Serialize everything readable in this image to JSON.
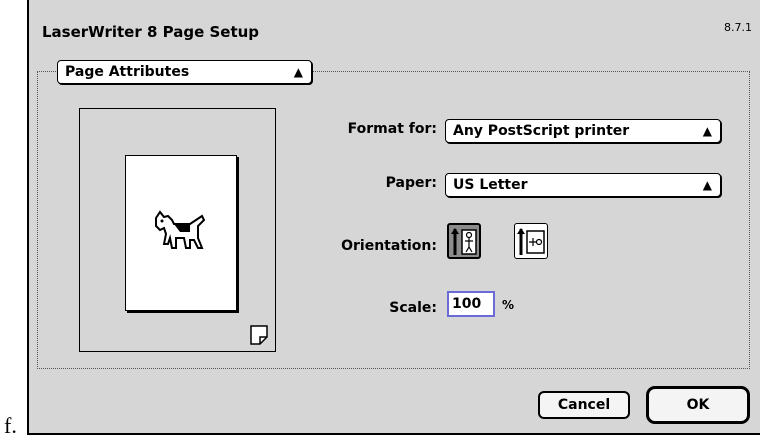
{
  "caption": "f.",
  "dialog": {
    "title": "LaserWriter 8 Page Setup",
    "version": "8.7.1",
    "panel_popup": "Page Attributes",
    "format_label": "Format for:",
    "format_value": "Any PostScript printer",
    "paper_label": "Paper:",
    "paper_value": "US Letter",
    "orientation_label": "Orientation:",
    "orientation_selected": "portrait",
    "scale_label": "Scale:",
    "scale_value": "100",
    "scale_unit": "%",
    "cancel_label": "Cancel",
    "ok_label": "OK"
  },
  "icons": {
    "preview": "dogcow-icon",
    "portrait": "portrait-orientation-icon",
    "landscape": "landscape-orientation-icon"
  },
  "colors": {
    "dialog_bg": "#d6d6d6",
    "scale_focus": "#6a6ad8",
    "selected_orientation": "#8c8c8c"
  }
}
